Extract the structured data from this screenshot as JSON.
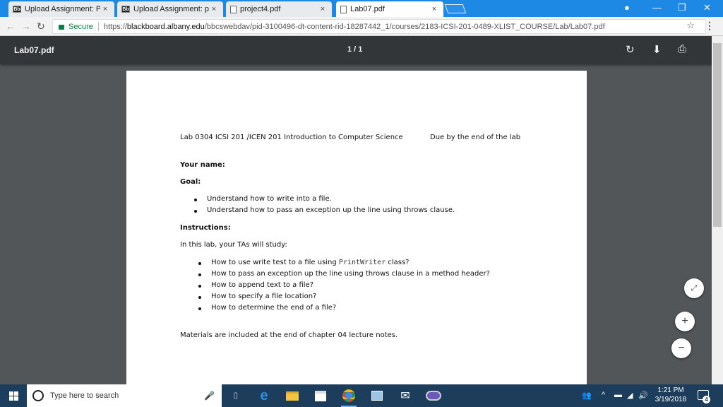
{
  "browser": {
    "tabs": [
      {
        "favicon": "Bb",
        "title": "Upload Assignment: Proj"
      },
      {
        "favicon": "Bb",
        "title": "Upload Assignment: proj"
      },
      {
        "favicon": "doc",
        "title": "project4.pdf"
      },
      {
        "favicon": "doc",
        "title": "Lab07.pdf",
        "active": true
      }
    ],
    "close_glyph": "×",
    "secure_label": "Secure",
    "url_scheme": "https://",
    "url_host": "blackboard.albany.edu",
    "url_path": "/bbcswebdav/pid-3100496-dt-content-rid-18287442_1/courses/2183-ICSI-201-0489-XLIST_COURSE/Lab/Lab07.pdf"
  },
  "pdf_viewer": {
    "title": "Lab07.pdf",
    "page_indicator": "1 / 1",
    "icons": [
      "rotate-icon",
      "download-icon",
      "print-icon",
      "fit-page-icon",
      "zoom-in-icon",
      "zoom-out-icon"
    ]
  },
  "document": {
    "header_left": "Lab 0304 ICSI 201 /ICEN 201 Introduction to Computer Science",
    "header_right": "Due by the end of the lab",
    "your_name_label": "Your name:",
    "goal_label": "Goal:",
    "goals": [
      "Understand how to write into a file.",
      "Understand how to pass an exception up the line using throws clause."
    ],
    "instructions_label": "Instructions:",
    "intro": "In this lab, your TAs will study:",
    "study_first_pre": "How to use write test to a file using ",
    "study_first_code": "PrintWriter",
    "study_first_post": " class?",
    "study_items": [
      "How to pass an exception up the line using throws clause in a method header?",
      "How to append text to a file?",
      "How to specify a file location?",
      "How to determine the end of a file?"
    ],
    "materials": "Materials are included at the end of chapter 04 lecture notes."
  },
  "taskbar": {
    "search_placeholder": "Type here to search",
    "time": "1:21 PM",
    "date": "3/19/2018",
    "notification_count": "4",
    "apps": [
      "task-view-icon",
      "edge-icon",
      "file-explorer-icon",
      "store-icon",
      "chrome-icon",
      "photos-icon",
      "mail-icon",
      "app-icon"
    ]
  },
  "colors": {
    "titlebar": "#1e88e5",
    "pdf_toolbar": "#323639",
    "pdf_background": "#525659",
    "taskbar": "#1d3d5c",
    "secure_green": "#0b8043"
  }
}
